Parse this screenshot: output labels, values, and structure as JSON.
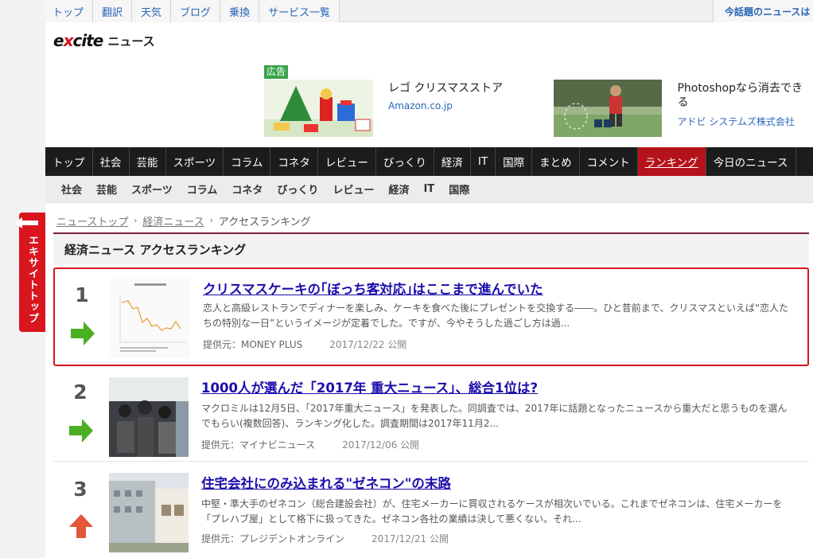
{
  "topbar": {
    "links": [
      "トップ",
      "翻訳",
      "天気",
      "ブログ",
      "乗換",
      "サービス一覧"
    ],
    "trending": "今話題のニュースは"
  },
  "logo": {
    "brand_pre": "e",
    "brand_x": "x",
    "brand_post": "cite",
    "suffix": "ニュース"
  },
  "ads": {
    "label": "広告",
    "items": [
      {
        "title": "レゴ クリスマスストア",
        "source": "Amazon.co.jp"
      },
      {
        "title": "Photoshopなら消去できる",
        "source": "アドビ システムズ株式会社"
      }
    ]
  },
  "nav": {
    "items": [
      "トップ",
      "社会",
      "芸能",
      "スポーツ",
      "コラム",
      "コネタ",
      "レビュー",
      "びっくり",
      "経済",
      "IT",
      "国際",
      "まとめ",
      "コメント",
      "ランキング",
      "今日のニュース"
    ],
    "active": "ランキング"
  },
  "subnav": [
    "社会",
    "芸能",
    "スポーツ",
    "コラム",
    "コネタ",
    "びっくり",
    "レビュー",
    "経済",
    "IT",
    "国際"
  ],
  "breadcrumb": {
    "home": "ニューストップ",
    "category": "経済ニュース",
    "current": "アクセスランキング"
  },
  "section_title": "経済ニュース アクセスランキング",
  "side_tab": "エキサイトトップ",
  "rankings": [
    {
      "rank": "1",
      "trend": "flat",
      "headline": "クリスマスケーキの｢ぼっち客対応｣はここまで進んでいた",
      "desc": "恋人と高級レストランでディナーを楽しみ、ケーキを食べた後にプレゼントを交換する――。ひと昔前まで、クリスマスといえば“恋人たちの特別な一日”というイメージが定着でした。ですが、今やそうした過ごし方は過...",
      "provider": "提供元：MONEY PLUS",
      "date": "2017/12/22 公開"
    },
    {
      "rank": "2",
      "trend": "flat",
      "headline": "1000人が選んだ「2017年 重大ニュース」、総合1位は?",
      "desc": "マクロミルは12月5日、「2017年重大ニュース」を発表した。同調査では、2017年に話題となったニュースから重大だと思うものを選んでもらい(複数回答)、ランキング化した。調査期間は2017年11月2...",
      "provider": "提供元：マイナビニュース",
      "date": "2017/12/06 公開"
    },
    {
      "rank": "3",
      "trend": "up",
      "headline": "住宅会社にのみ込まれる\"ゼネコン\"の末路",
      "desc": "中堅・準大手のゼネコン（総合建設会社）が、住宅メーカーに買収されるケースが相次いでいる。これまでゼネコンは、住宅メーカーを「プレハブ屋」として格下に扱ってきた。ゼネコン各社の業績は決して悪くない。それ...",
      "provider": "提供元：プレジデントオンライン",
      "date": "2017/12/21 公開"
    }
  ],
  "colors": {
    "accent_red": "#d9151e",
    "trend_flat": "#4caf21",
    "trend_up": "#e0573c",
    "link": "#1a0dab"
  }
}
